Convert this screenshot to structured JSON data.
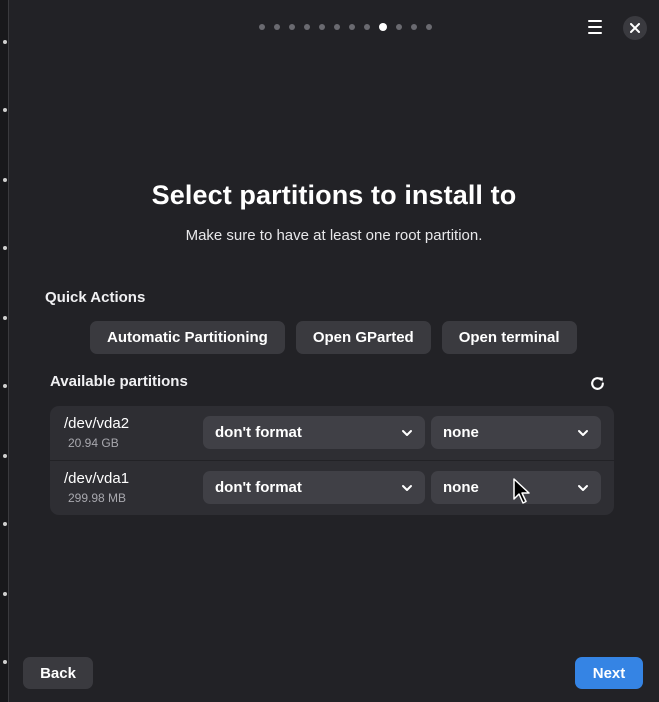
{
  "pager": {
    "total": 12,
    "active_index": 8
  },
  "header": {
    "menu_icon": "hamburger-menu-icon",
    "close_icon": "close-icon"
  },
  "main": {
    "title": "Select partitions to install to",
    "subtitle": "Make sure to have at least one root partition."
  },
  "quick_actions": {
    "label": "Quick Actions",
    "buttons": [
      {
        "label": "Automatic Partitioning"
      },
      {
        "label": "Open GParted"
      },
      {
        "label": "Open terminal"
      }
    ]
  },
  "partitions": {
    "label": "Available partitions",
    "refresh_icon": "refresh-icon",
    "rows": [
      {
        "device": "/dev/vda2",
        "size": "20.94 GB",
        "format": "don't format",
        "mount": "none"
      },
      {
        "device": "/dev/vda1",
        "size": "299.98 MB",
        "format": "don't format",
        "mount": "none"
      }
    ]
  },
  "footer": {
    "back_label": "Back",
    "next_label": "Next"
  },
  "colors": {
    "background": "#222226",
    "accent": "#3584e4",
    "button": "#3a3a3f"
  }
}
